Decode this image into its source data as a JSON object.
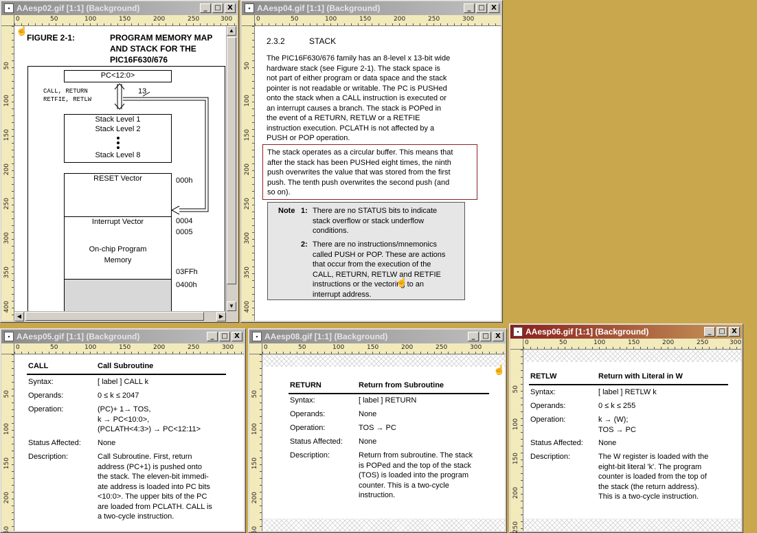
{
  "w1": {
    "title": "AAesp02.gif [1:1] (Background)",
    "ruler_top": [
      "0",
      "50",
      "100",
      "150",
      "200",
      "250",
      "300"
    ],
    "ruler_left": [
      "50",
      "100",
      "150",
      "200",
      "250",
      "300",
      "350",
      "400"
    ],
    "figure_label": "FIGURE 2-1:",
    "figure_title_1": "PROGRAM MEMORY MAP",
    "figure_title_2": "AND STACK FOR THE",
    "figure_title_3": "PIC16F630/676",
    "pc": "PC<12:0>",
    "calls_1": "CALL, RETURN",
    "calls_2": "RETFIE, RETLW",
    "bits": "13",
    "stack_1": "Stack Level 1",
    "stack_2": "Stack Level 2",
    "stack_8": "Stack Level 8",
    "reset": "RESET Vector",
    "addr_000": "000h",
    "interrupt": "Interrupt Vector",
    "addr_0004": "0004",
    "addr_0005": "0005",
    "onchip_1": "On-chip Program",
    "onchip_2": "Memory",
    "addr_03ff": "03FFh",
    "addr_0400": "0400h"
  },
  "w2": {
    "title": "AAesp04.gif [1:1] (Background)",
    "ruler_top": [
      "0",
      "50",
      "100",
      "150",
      "200",
      "250",
      "300"
    ],
    "ruler_left": [
      "50",
      "100",
      "150",
      "200",
      "250",
      "300",
      "350",
      "400"
    ],
    "section_num": "2.3.2",
    "section_title": "STACK",
    "para_lines": [
      "The PIC16F630/676 family has an 8-level x 13-bit wide",
      "hardware stack (see Figure 2-1). The stack space is",
      "not part of either program or data space and the stack",
      "pointer is not readable or writable. The PC is PUSHed",
      "onto the stack when a CALL instruction is executed or",
      "an interrupt causes a branch. The stack is POPed in",
      "the event of a RETURN,  RETLW or a RETFIE",
      "instruction execution. PCLATH is not affected by a",
      "PUSH or POP operation."
    ],
    "boxed_lines": [
      "The stack operates as a circular buffer. This means that",
      "after the stack has been PUSHed eight times, the ninth",
      "push overwrites the value that was stored from the first",
      "push. The tenth push overwrites the second push (and",
      "so on)."
    ],
    "note_label": "Note",
    "note1_num": "1:",
    "note1_lines": [
      "There are no STATUS bits to indicate",
      "stack overflow or stack underflow",
      "conditions."
    ],
    "note2_num": "2:",
    "note2_lines": [
      "There are no instructions/mnemonics",
      "called PUSH or POP. These are actions",
      "that occur from the execution of the",
      "CALL, RETURN, RETLW and RETFIE",
      "instructions or the vectoring to an",
      "interrupt address."
    ]
  },
  "w3": {
    "title": "AAesp05.gif [1:1] (Background)",
    "ruler_top": [
      "0",
      "50",
      "100",
      "150",
      "200",
      "250",
      "300"
    ],
    "ruler_left": [
      "50",
      "100",
      "150",
      "200",
      "250"
    ],
    "mnemonic": "CALL",
    "heading": "Call Subroutine",
    "syntax_label": "Syntax:",
    "syntax_value": "[ label ]   CALL   k",
    "operands_label": "Operands:",
    "operands_value": "0 ≤ k ≤ 2047",
    "operation_label": "Operation:",
    "operation_lines": [
      "(PC)+ 1→ TOS,",
      "k → PC<10:0>,",
      "(PCLATH<4:3>) → PC<12:11>"
    ],
    "status_label": "Status Affected:",
    "status_value": "None",
    "desc_label": "Description:",
    "desc_lines": [
      "Call Subroutine. First, return",
      "address (PC+1) is pushed onto",
      "the stack. The eleven-bit immedi-",
      "ate address is loaded into PC bits",
      "<10:0>. The upper bits of the PC",
      "are loaded from PCLATH. CALL is",
      "a two-cycle instruction."
    ]
  },
  "w4": {
    "title": "AAesp08.gif [1:1] (Background)",
    "ruler_top": [
      "0",
      "50",
      "100",
      "150",
      "200",
      "250",
      "300"
    ],
    "ruler_left": [
      "50",
      "100",
      "150",
      "200",
      "250"
    ],
    "mnemonic": "RETURN",
    "heading": "Return from Subroutine",
    "syntax_label": "Syntax:",
    "syntax_value": "[ label ]    RETURN",
    "operands_label": "Operands:",
    "operands_value": "None",
    "operation_label": "Operation:",
    "operation_value": "TOS → PC",
    "status_label": "Status Affected:",
    "status_value": "None",
    "desc_label": "Description:",
    "desc_lines": [
      "Return from subroutine. The stack",
      "is POPed and the top of the stack",
      "(TOS) is loaded into the program",
      "counter. This is a two-cycle",
      "instruction."
    ]
  },
  "w5": {
    "title": "AAesp06.gif [1:1] (Background)",
    "ruler_top": [
      "0",
      "50",
      "100",
      "150",
      "200",
      "250",
      "300"
    ],
    "ruler_left": [
      "50",
      "100",
      "150",
      "200",
      "250"
    ],
    "mnemonic": "RETLW",
    "heading": "Return with Literal in W",
    "syntax_label": "Syntax:",
    "syntax_value": "[ label ]   RETLW   k",
    "operands_label": "Operands:",
    "operands_value": "0 ≤ k ≤ 255",
    "operation_label": "Operation:",
    "operation_lines": [
      "k → (W);",
      "TOS → PC"
    ],
    "status_label": "Status Affected:",
    "status_value": "None",
    "desc_label": "Description:",
    "desc_lines": [
      "The W register is loaded with the",
      "eight-bit literal 'k'. The program",
      "counter is loaded from the top of",
      "the stack (the return address).",
      "This is a two-cycle instruction."
    ]
  },
  "buttons": {
    "minimize": "_",
    "maximize": "□",
    "close": "X"
  },
  "colors": {
    "desktop": "#c9a74c",
    "active_title": "#8a1e1e",
    "inactive_title": "#8c8c8c",
    "highlight_box": "#8b2020",
    "note_bg": "#e6e6e6"
  }
}
